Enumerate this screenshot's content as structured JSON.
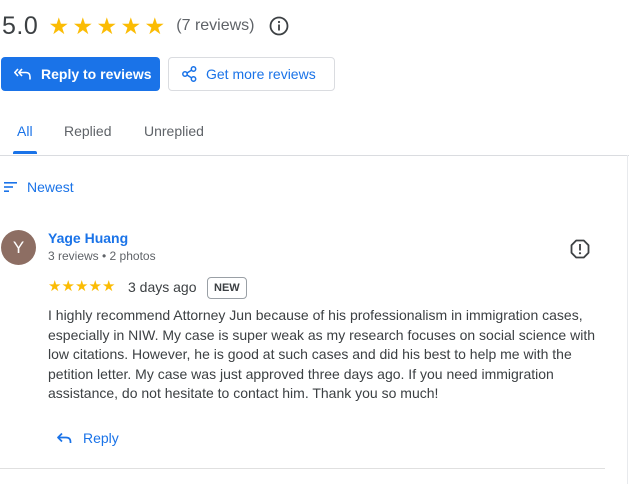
{
  "summary": {
    "score": "5.0",
    "star_count": 5,
    "review_count": "(7 reviews)"
  },
  "actions": {
    "reply_to_reviews": "Reply to reviews",
    "get_more_reviews": "Get more reviews"
  },
  "tabs": [
    {
      "label": "All",
      "active": true
    },
    {
      "label": "Replied",
      "active": false
    },
    {
      "label": "Unreplied",
      "active": false
    }
  ],
  "sort": {
    "label": "Newest"
  },
  "review": {
    "avatar_letter": "Y",
    "name": "Yage Huang",
    "meta": "3 reviews • 2 photos",
    "rating": 5,
    "date": "3 days ago",
    "badge": "NEW",
    "text": "I highly recommend Attorney Jun because of his professionalism in immigration cases, especially in NIW. My case is super weak as my research focuses on social science with low citations. However, he is good at such cases and did his best to help me with the petition letter. My case was just approved three days ago. If you need immigration assistance, do not hesitate to contact him. Thank you so much!",
    "reply_label": "Reply"
  },
  "colors": {
    "accent": "#1a73e8",
    "star": "#fbbc04",
    "avatar": "#8d6e63"
  },
  "icons": {
    "info": "info-icon",
    "reply": "reply-arrow-icon",
    "share": "share-icon",
    "sort": "sort-lines-icon",
    "flag": "report-flag-icon",
    "star": "star-icon"
  }
}
